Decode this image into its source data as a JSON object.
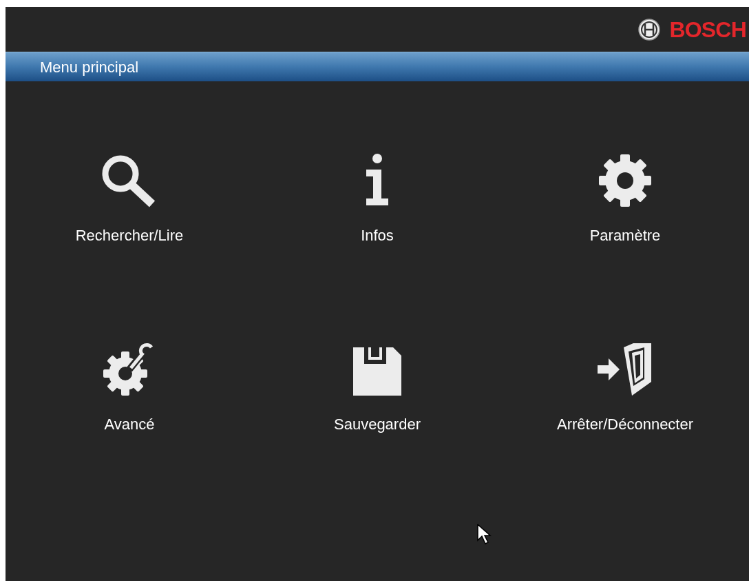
{
  "brand": {
    "name": "BOSCH"
  },
  "header": {
    "title": "Menu principal"
  },
  "menu_items": [
    {
      "kind": "search",
      "label": "Rechercher/Lire"
    },
    {
      "kind": "info",
      "label": "Infos"
    },
    {
      "kind": "gear",
      "label": "Paramètre"
    },
    {
      "kind": "tools",
      "label": "Avancé"
    },
    {
      "kind": "save",
      "label": "Sauvegarder"
    },
    {
      "kind": "exit",
      "label": "Arrêter/Déconnecter"
    }
  ]
}
